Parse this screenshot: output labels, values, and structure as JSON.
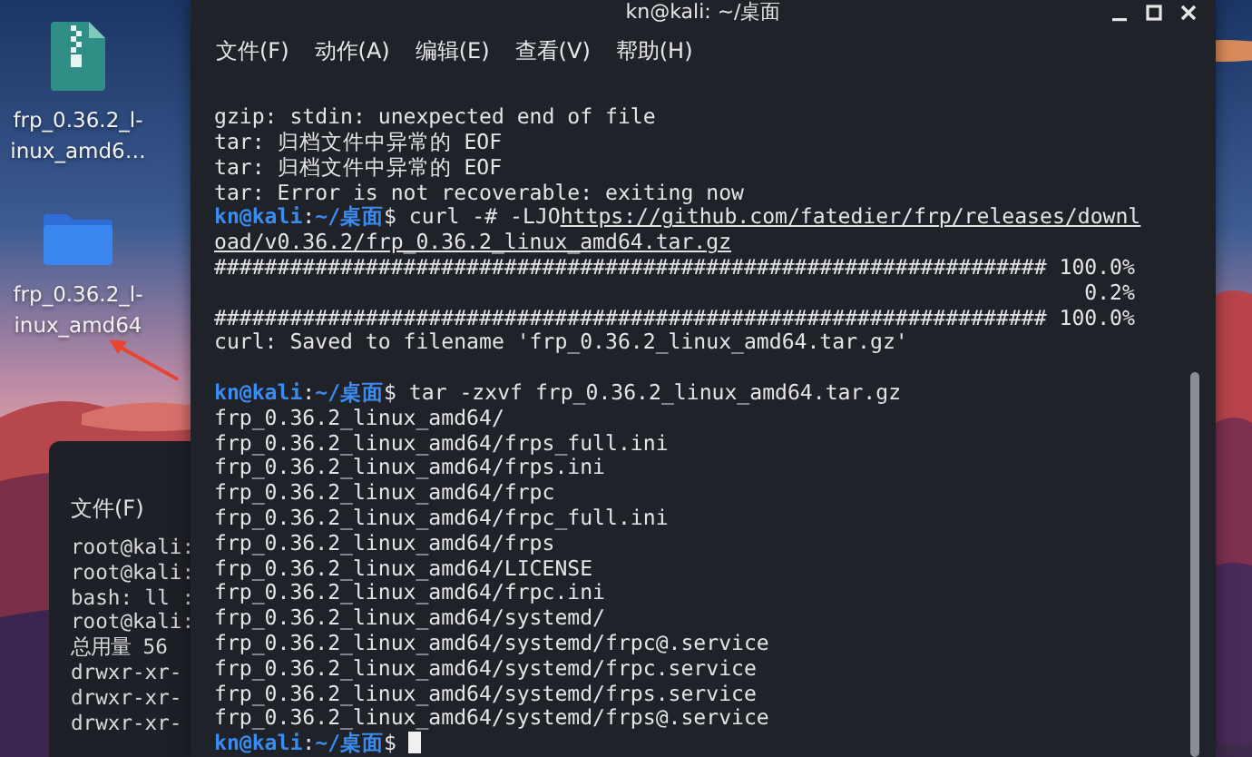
{
  "desktop_icons": [
    {
      "kind": "archive",
      "label_lines": [
        "frp_0.36.2_l-",
        "inux_amd6…"
      ]
    },
    {
      "kind": "folder",
      "label_lines": [
        "frp_0.36.2_l-",
        "inux_amd64"
      ]
    }
  ],
  "back_window": {
    "menu": [
      "文件(F)"
    ],
    "lines": [
      "root@kali:",
      "root@kali:",
      "bash: ll :",
      "root@kali:",
      "总用量 56",
      "drwxr-xr-",
      "drwxr-xr-",
      "drwxr-xr-"
    ]
  },
  "terminal": {
    "title": "kn@kali: ~/桌面",
    "menu": [
      "文件(F)",
      "动作(A)",
      "编辑(E)",
      "查看(V)",
      "帮助(H)"
    ],
    "lines": [
      {
        "kind": "output",
        "text": "gzip: stdin: unexpected end of file"
      },
      {
        "kind": "output",
        "text": "tar: 归档文件中异常的 EOF"
      },
      {
        "kind": "output",
        "text": "tar: 归档文件中异常的 EOF"
      },
      {
        "kind": "output",
        "text": "tar: Error is not recoverable: exiting now"
      },
      {
        "kind": "prompt",
        "user": "kn@kali",
        "colon": ":",
        "path": "~/桌面",
        "dollar": "$",
        "command": "curl -# -LJO",
        "link": "https://github.com/fatedier/frp/releases/downl"
      },
      {
        "kind": "link",
        "text": "oad/v0.36.2/frp_0.36.2_linux_amd64.tar.gz"
      },
      {
        "kind": "progress",
        "bar": "##################################################################",
        "percent": "100.0%"
      },
      {
        "kind": "progress",
        "percent": "0.2%"
      },
      {
        "kind": "progress",
        "bar": "##################################################################",
        "percent": "100.0%"
      },
      {
        "kind": "output",
        "text": "curl: Saved to filename 'frp_0.36.2_linux_amd64.tar.gz'"
      },
      {
        "kind": "blank"
      },
      {
        "kind": "prompt",
        "user": "kn@kali",
        "colon": ":",
        "path": "~/桌面",
        "dollar": "$",
        "command": "tar -zxvf frp_0.36.2_linux_amd64.tar.gz"
      },
      {
        "kind": "output",
        "text": "frp_0.36.2_linux_amd64/"
      },
      {
        "kind": "output",
        "text": "frp_0.36.2_linux_amd64/frps_full.ini"
      },
      {
        "kind": "output",
        "text": "frp_0.36.2_linux_amd64/frps.ini"
      },
      {
        "kind": "output",
        "text": "frp_0.36.2_linux_amd64/frpc"
      },
      {
        "kind": "output",
        "text": "frp_0.36.2_linux_amd64/frpc_full.ini"
      },
      {
        "kind": "output",
        "text": "frp_0.36.2_linux_amd64/frps"
      },
      {
        "kind": "output",
        "text": "frp_0.36.2_linux_amd64/LICENSE"
      },
      {
        "kind": "output",
        "text": "frp_0.36.2_linux_amd64/frpc.ini"
      },
      {
        "kind": "output",
        "text": "frp_0.36.2_linux_amd64/systemd/"
      },
      {
        "kind": "output",
        "text": "frp_0.36.2_linux_amd64/systemd/frpc@.service"
      },
      {
        "kind": "output",
        "text": "frp_0.36.2_linux_amd64/systemd/frpc.service"
      },
      {
        "kind": "output",
        "text": "frp_0.36.2_linux_amd64/systemd/frps.service"
      },
      {
        "kind": "output",
        "text": "frp_0.36.2_linux_amd64/systemd/frps@.service"
      },
      {
        "kind": "prompt",
        "user": "kn@kali",
        "colon": ":",
        "path": "~/桌面",
        "dollar": "$",
        "cursor": true
      }
    ]
  }
}
